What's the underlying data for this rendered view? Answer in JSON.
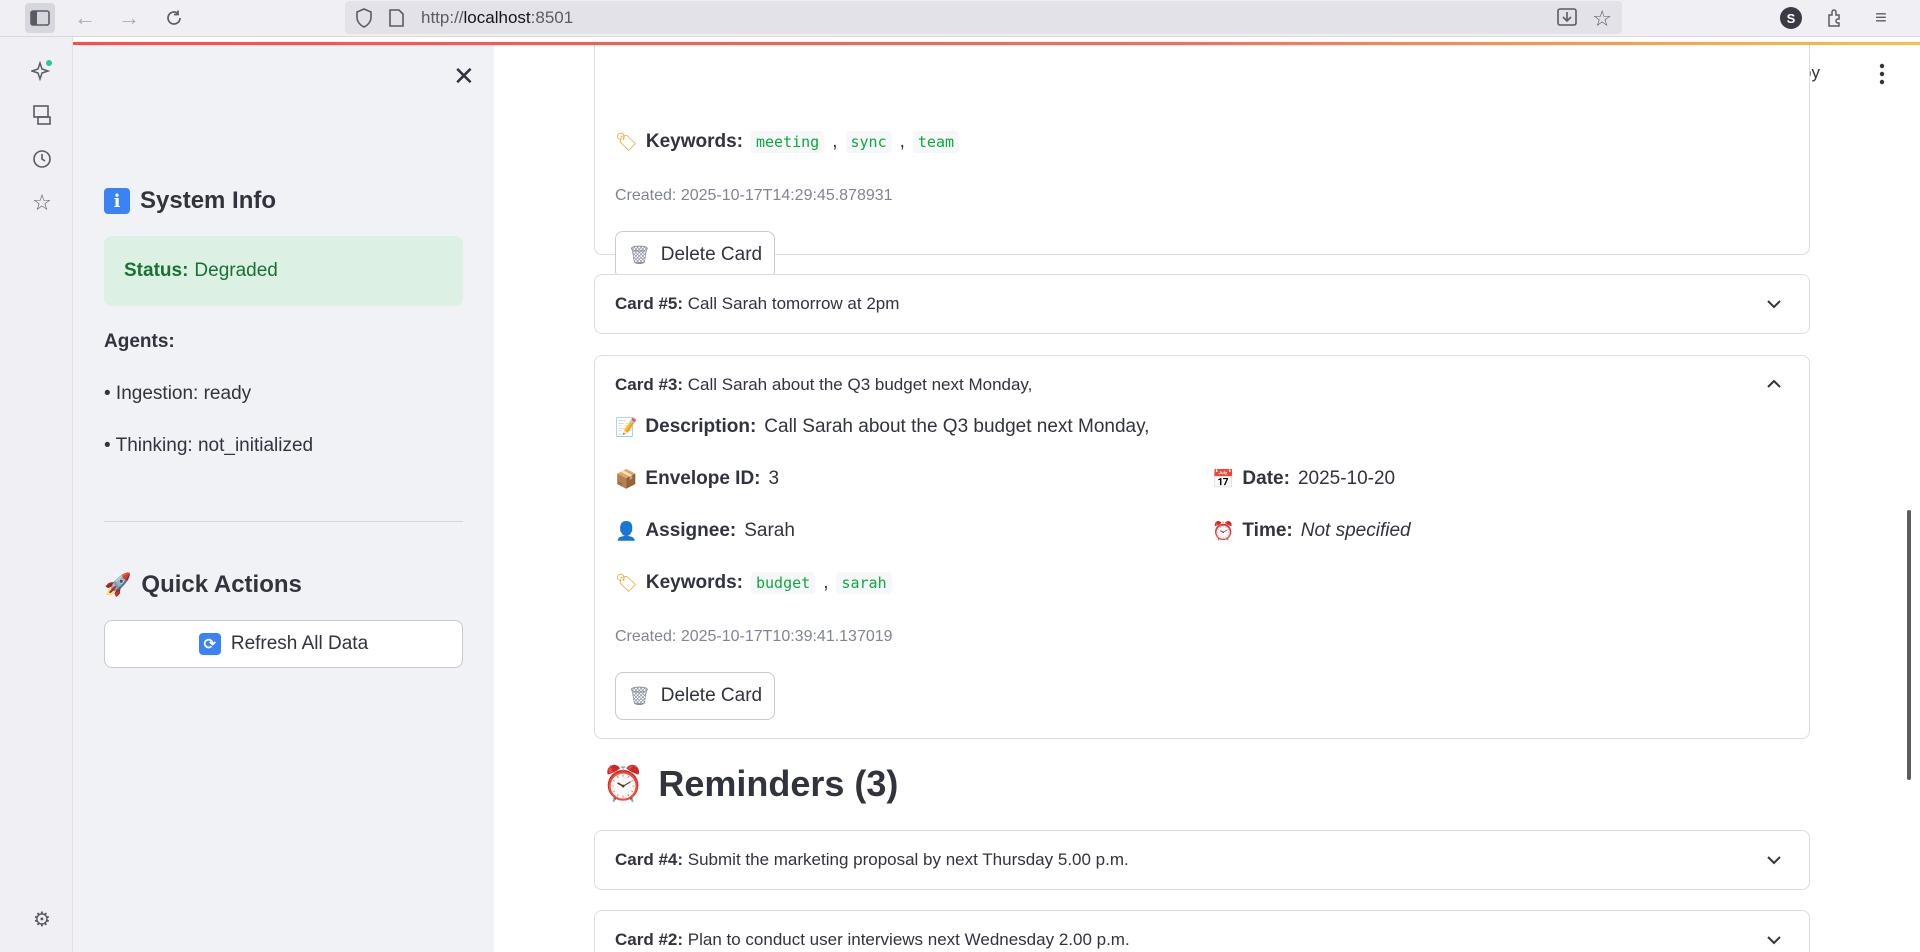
{
  "browser": {
    "url_prefix": "http://",
    "url_host": "localhost",
    "url_port": ":8501",
    "profile_initial": "S"
  },
  "sidebar": {
    "system_info_title": "System Info",
    "status_label": "Status:",
    "status_value": "Degraded",
    "agents_label": "Agents:",
    "agents": [
      "• Ingestion: ready",
      "• Thinking: not_initialized"
    ],
    "quick_actions_title": "Quick Actions",
    "refresh_label": "Refresh All Data"
  },
  "header": {
    "deploy_label": "Deploy"
  },
  "cards": {
    "top_partial": {
      "keywords_label": "Keywords:",
      "keywords": [
        "meeting",
        "sync",
        "team"
      ],
      "created": "Created: 2025-10-17T14:29:45.878931",
      "delete_label": "Delete Card"
    },
    "card5": {
      "number": "Card #5:",
      "title": "Call Sarah tomorrow at 2pm"
    },
    "card3": {
      "number": "Card #3:",
      "title": "Call Sarah about the Q3 budget next Monday,",
      "description_label": "Description:",
      "description": "Call Sarah about the Q3 budget next Monday,",
      "envelope_label": "Envelope ID:",
      "envelope": "3",
      "date_label": "Date:",
      "date": "2025-10-20",
      "assignee_label": "Assignee:",
      "assignee": "Sarah",
      "time_label": "Time:",
      "time": "Not specified",
      "keywords_label": "Keywords:",
      "keywords": [
        "budget",
        "sarah"
      ],
      "created": "Created: 2025-10-17T10:39:41.137019",
      "delete_label": "Delete Card"
    }
  },
  "reminders": {
    "title": "Reminders (3)",
    "items": [
      {
        "number": "Card #4:",
        "title": "Submit the marketing proposal by next Thursday 5.00 p.m."
      },
      {
        "number": "Card #2:",
        "title": "Plan to conduct user interviews next Wednesday 2.00 p.m."
      }
    ]
  }
}
